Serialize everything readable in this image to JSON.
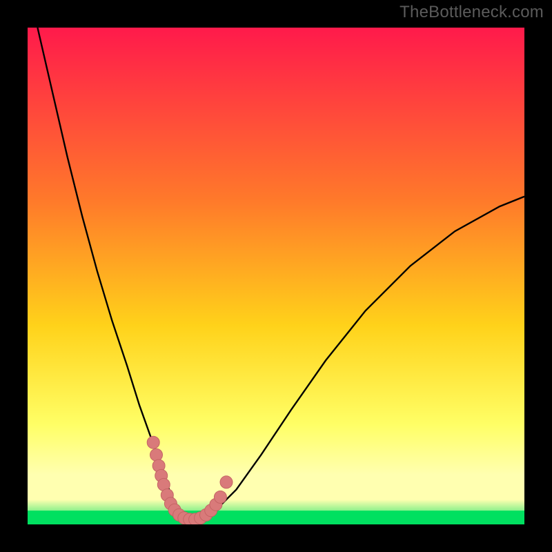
{
  "watermark": "TheBottleneck.com",
  "colors": {
    "bg_black": "#000000",
    "grad_top": "#ff1a4b",
    "grad_mid1": "#ff7a2a",
    "grad_mid2": "#ffd21a",
    "grad_mid3": "#ffff66",
    "grad_band_light": "#ffffb0",
    "grad_bottom": "#00e060",
    "curve_stroke": "#000000",
    "dot_fill": "#d97a7a",
    "dot_stroke": "#c46464"
  },
  "chart_data": {
    "type": "line",
    "title": "",
    "xlabel": "",
    "ylabel": "",
    "xlim": [
      0,
      100
    ],
    "ylim": [
      0,
      100
    ],
    "series": [
      {
        "name": "bottleneck-curve",
        "x": [
          2,
          5,
          8,
          11,
          14,
          17,
          20,
          22.5,
          25,
          27,
          28.5,
          30,
          31.5,
          33,
          35,
          38,
          42,
          47,
          53,
          60,
          68,
          77,
          86,
          95,
          100
        ],
        "values": [
          100,
          87,
          74,
          62,
          51,
          41,
          32,
          24,
          17,
          11,
          7,
          3.5,
          1.5,
          1,
          1.2,
          3,
          7,
          14,
          23,
          33,
          43,
          52,
          59,
          64,
          66
        ]
      }
    ],
    "scatter_overlay": {
      "name": "sample-dots",
      "points": [
        {
          "x": 25.3,
          "y": 16.5
        },
        {
          "x": 25.9,
          "y": 14.0
        },
        {
          "x": 26.4,
          "y": 11.8
        },
        {
          "x": 26.9,
          "y": 9.8
        },
        {
          "x": 27.4,
          "y": 8.0
        },
        {
          "x": 28.1,
          "y": 5.9
        },
        {
          "x": 28.8,
          "y": 4.2
        },
        {
          "x": 29.6,
          "y": 2.9
        },
        {
          "x": 30.5,
          "y": 1.9
        },
        {
          "x": 31.5,
          "y": 1.3
        },
        {
          "x": 32.6,
          "y": 1.0
        },
        {
          "x": 33.7,
          "y": 1.0
        },
        {
          "x": 34.8,
          "y": 1.3
        },
        {
          "x": 35.9,
          "y": 1.9
        },
        {
          "x": 36.9,
          "y": 2.8
        },
        {
          "x": 37.9,
          "y": 4.0
        },
        {
          "x": 38.8,
          "y": 5.5
        },
        {
          "x": 40.0,
          "y": 8.5
        }
      ]
    }
  }
}
